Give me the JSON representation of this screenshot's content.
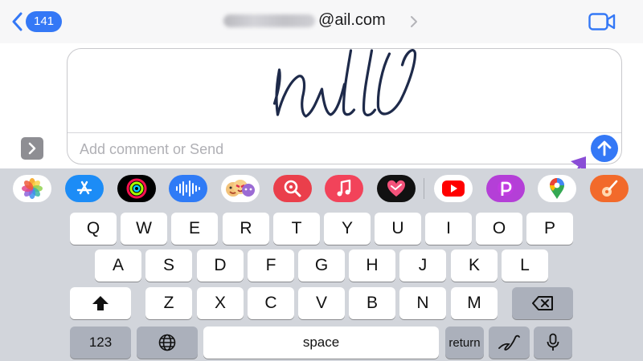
{
  "header": {
    "unread_count": "141",
    "recipient_visible": "ail.com",
    "recipient_at": "@"
  },
  "composer": {
    "placeholder": "Add comment or Send"
  },
  "app_drawer": {
    "apps": [
      {
        "name": "Photos",
        "icon": "photos-icon"
      },
      {
        "name": "App Store",
        "icon": "app-store-icon"
      },
      {
        "name": "Activity",
        "icon": "activity-rings-icon"
      },
      {
        "name": "Audio Message",
        "icon": "audio-waveform-icon"
      },
      {
        "name": "Memoji Stickers",
        "icon": "memoji-icon"
      },
      {
        "name": "Image Search",
        "icon": "image-search-icon"
      },
      {
        "name": "Music",
        "icon": "music-icon"
      },
      {
        "name": "Digital Touch",
        "icon": "digital-touch-icon"
      },
      {
        "name": "YouTube",
        "icon": "youtube-icon"
      },
      {
        "name": "Picsart",
        "icon": "picsart-icon"
      },
      {
        "name": "Google Maps",
        "icon": "google-maps-icon"
      },
      {
        "name": "GarageBand",
        "icon": "garageband-icon"
      }
    ]
  },
  "keyboard": {
    "row1": [
      "Q",
      "W",
      "E",
      "R",
      "T",
      "Y",
      "U",
      "I",
      "O",
      "P"
    ],
    "row2": [
      "A",
      "S",
      "D",
      "F",
      "G",
      "H",
      "J",
      "K",
      "L"
    ],
    "row3": [
      "Z",
      "X",
      "C",
      "V",
      "B",
      "N",
      "M"
    ],
    "numbers_label": "123",
    "space_label": "space",
    "return_label": "return"
  },
  "colors": {
    "accent": "#3478f6",
    "keyboard_bg": "#d2d5db",
    "function_key": "#abb0bb",
    "annotation_arrow": "#8a4dd6",
    "ink": "#1e2a4a"
  }
}
